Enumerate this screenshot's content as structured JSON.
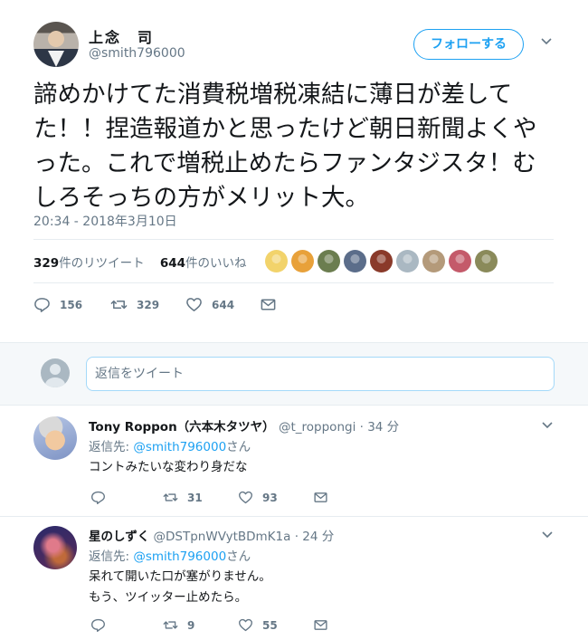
{
  "author": {
    "name": "上念　司",
    "handle": "@smith796000"
  },
  "follow_button": "フォローする",
  "tweet": {
    "text": "諦めかけてた消費税増税凍結に薄日が差してた！！捏造報道かと思ったけど朝日新聞よくやった。これで増税止めたらファンタジスタ！むしろそっちの方がメリット大。",
    "timestamp": "20:34 - 2018年3月10日"
  },
  "stats": {
    "retweets_count": "329",
    "retweets_label": "件のリツイート",
    "likes_count": "644",
    "likes_label": "件のいいね"
  },
  "likers": [
    "#f2d36b",
    "#e8a13a",
    "#6b7d4f",
    "#5b6d8a",
    "#8a3a2a",
    "#aab8c2",
    "#b49a7a",
    "#c45a6a",
    "#8a8a5a"
  ],
  "actions": {
    "reply_count": "156",
    "retweet_count": "329",
    "like_count": "644"
  },
  "reply_box": {
    "placeholder": "返信をツイート"
  },
  "replies": [
    {
      "name": "Tony Roppon（六本木タツヤ）",
      "handle": "@t_roppongi",
      "time": "· 34 分",
      "reply_to_label": "返信先: ",
      "reply_to_mention": "@smith796000",
      "reply_to_suffix": "さん",
      "body_lines": [
        "コントみたいな変わり身だな"
      ],
      "reply_count": "",
      "retweet_count": "31",
      "like_count": "93"
    },
    {
      "name": "星のしずく",
      "handle": "@DSTpnWVytBDmK1a",
      "time": "· 24 分",
      "reply_to_label": "返信先: ",
      "reply_to_mention": "@smith796000",
      "reply_to_suffix": "さん",
      "body_lines": [
        "呆れて開いた口が塞がりません。",
        "もう、ツイッター止めたら。"
      ],
      "reply_count": "",
      "retweet_count": "9",
      "like_count": "55"
    }
  ],
  "colors": {
    "accent": "#1da1f2",
    "secondary_text": "#657786",
    "divider": "#e6ecf0"
  }
}
